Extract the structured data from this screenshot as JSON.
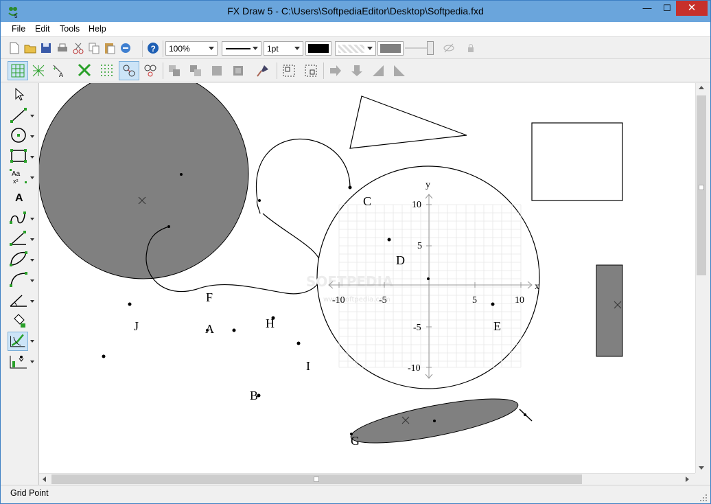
{
  "window": {
    "title": "FX Draw 5 - C:\\Users\\SoftpediaEditor\\Desktop\\Softpedia.fxd",
    "min_glyph": "—",
    "max_glyph": "☐",
    "close_glyph": "✕"
  },
  "menu": {
    "file": "File",
    "edit": "Edit",
    "tools": "Tools",
    "help": "Help"
  },
  "toolbar": {
    "zoom": "100%",
    "line_width": "1pt",
    "colors": {
      "line": "#000000",
      "fill": "#808080",
      "accent_green": "#2aa02a",
      "accent_blue": "#1e5fb4",
      "selected_bg": "#cce4f7"
    }
  },
  "canvas": {
    "labels": {
      "C": "C",
      "D": "D",
      "E": "E",
      "F": "F",
      "G": "G",
      "H": "H",
      "I": "I",
      "J": "J",
      "A": "A",
      "B": "B"
    },
    "axes": {
      "x_label": "x",
      "y_label": "y",
      "ticks": {
        "t_neg10": "-10",
        "t_neg5": "-5",
        "t_5": "5",
        "t_10": "10"
      },
      "watermark": "SOFTPEDIA",
      "watermark_sub": "www.softpedia.com"
    }
  },
  "status": {
    "text": "Grid Point"
  }
}
